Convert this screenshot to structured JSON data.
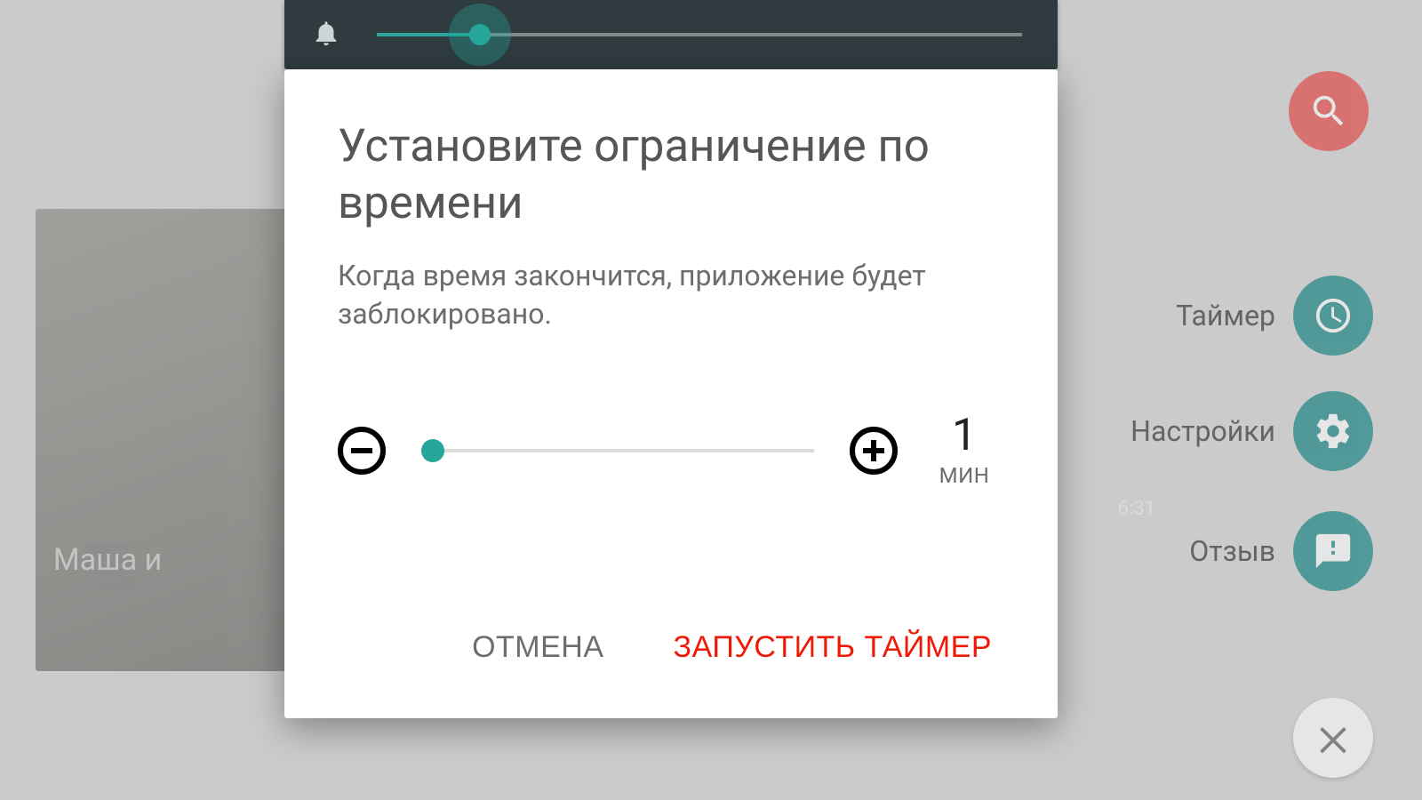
{
  "background": {
    "tile_caption": "Маша и",
    "duration_sample": "6:31",
    "side": {
      "timer": "Таймер",
      "settings": "Настройки",
      "feedback": "Отзыв"
    }
  },
  "topbar": {
    "volume_percent": 16
  },
  "dialog": {
    "title": "Установите ограничение по времени",
    "description": "Когда время закончится, приложение будет заблокировано.",
    "value": "1",
    "unit": "МИН",
    "slider_percent": 3,
    "cancel": "ОТМЕНА",
    "start": "ЗАПУСТИТЬ ТАЙМЕР"
  }
}
